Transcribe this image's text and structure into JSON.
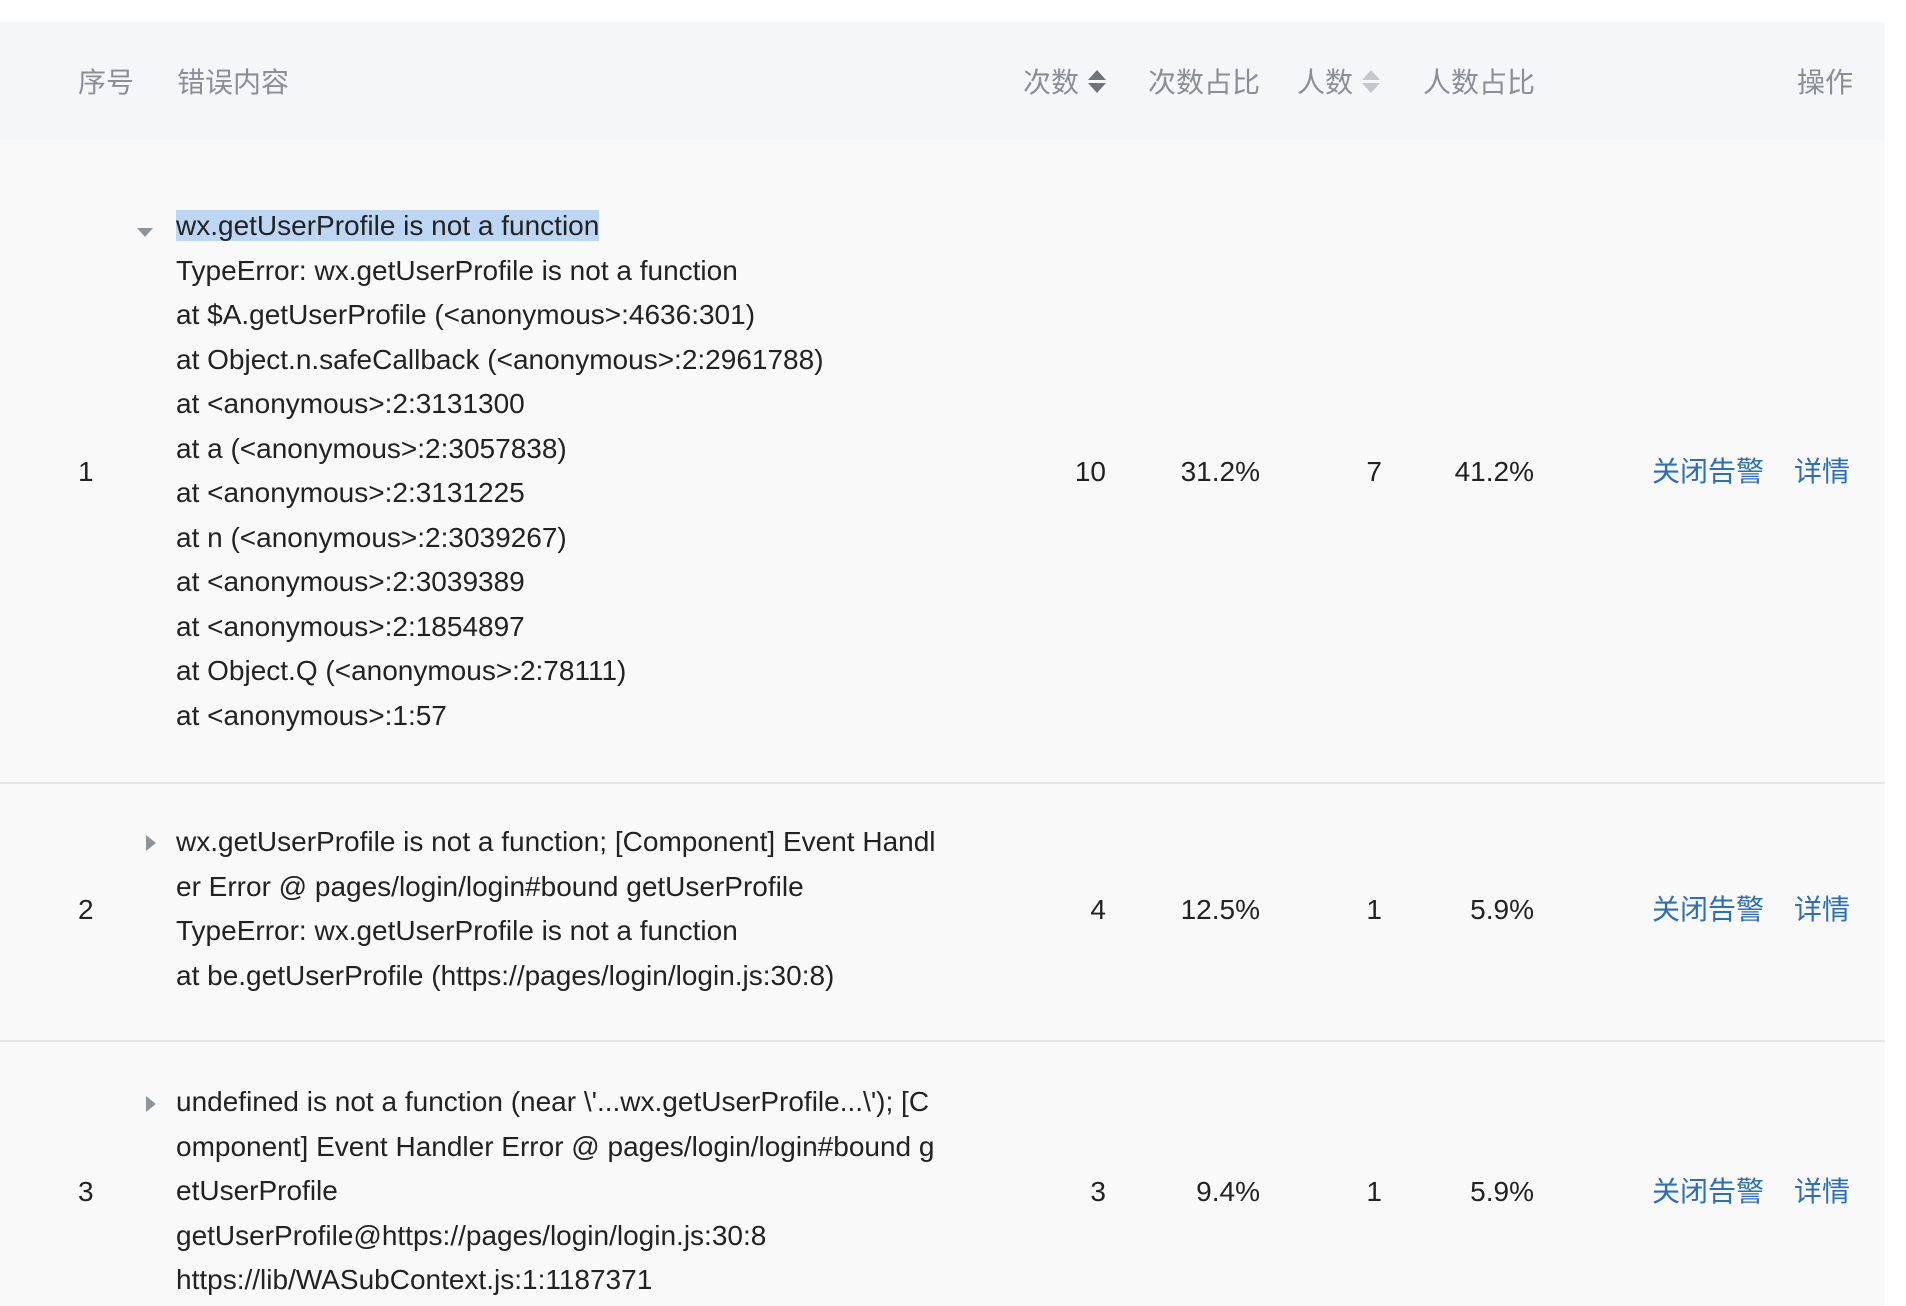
{
  "header": {
    "index": "序号",
    "error": "错误内容",
    "count": "次数",
    "count_ratio": "次数占比",
    "users": "人数",
    "users_ratio": "人数占比",
    "action": "操作"
  },
  "rows": [
    {
      "index": "1",
      "expanded": true,
      "lines": [
        "wx.getUserProfile is not a function",
        "TypeError: wx.getUserProfile is not a function",
        "at $A.getUserProfile (<anonymous>:4636:301)",
        "at Object.n.safeCallback (<anonymous>:2:2961788)",
        "at <anonymous>:2:3131300",
        "at a (<anonymous>:2:3057838)",
        "at <anonymous>:2:3131225",
        "at n (<anonymous>:2:3039267)",
        "at <anonymous>:2:3039389",
        "at <anonymous>:2:1854897",
        "at Object.Q (<anonymous>:2:78111)",
        "at <anonymous>:1:57"
      ],
      "count": "10",
      "count_ratio": "31.2%",
      "users": "7",
      "users_ratio": "41.2%",
      "close_alert": "关闭告警",
      "details": "详情"
    },
    {
      "index": "2",
      "expanded": false,
      "lines": [
        "wx.getUserProfile is not a function; [Component] Event Handl",
        "er Error @ pages/login/login#bound getUserProfile",
        "TypeError: wx.getUserProfile is not a function",
        "at be.getUserProfile (https://pages/login/login.js:30:8)"
      ],
      "count": "4",
      "count_ratio": "12.5%",
      "users": "1",
      "users_ratio": "5.9%",
      "close_alert": "关闭告警",
      "details": "详情"
    },
    {
      "index": "3",
      "expanded": false,
      "lines": [
        "undefined is not a function (near \\'...wx.getUserProfile...\\'); [C",
        "omponent] Event Handler Error @ pages/login/login#bound g",
        "etUserProfile",
        "getUserProfile@https://pages/login/login.js:30:8",
        "https://lib/WASubContext.js:1:1187371"
      ],
      "count": "3",
      "count_ratio": "9.4%",
      "users": "1",
      "users_ratio": "5.9%",
      "close_alert": "关闭告警",
      "details": "详情"
    }
  ]
}
